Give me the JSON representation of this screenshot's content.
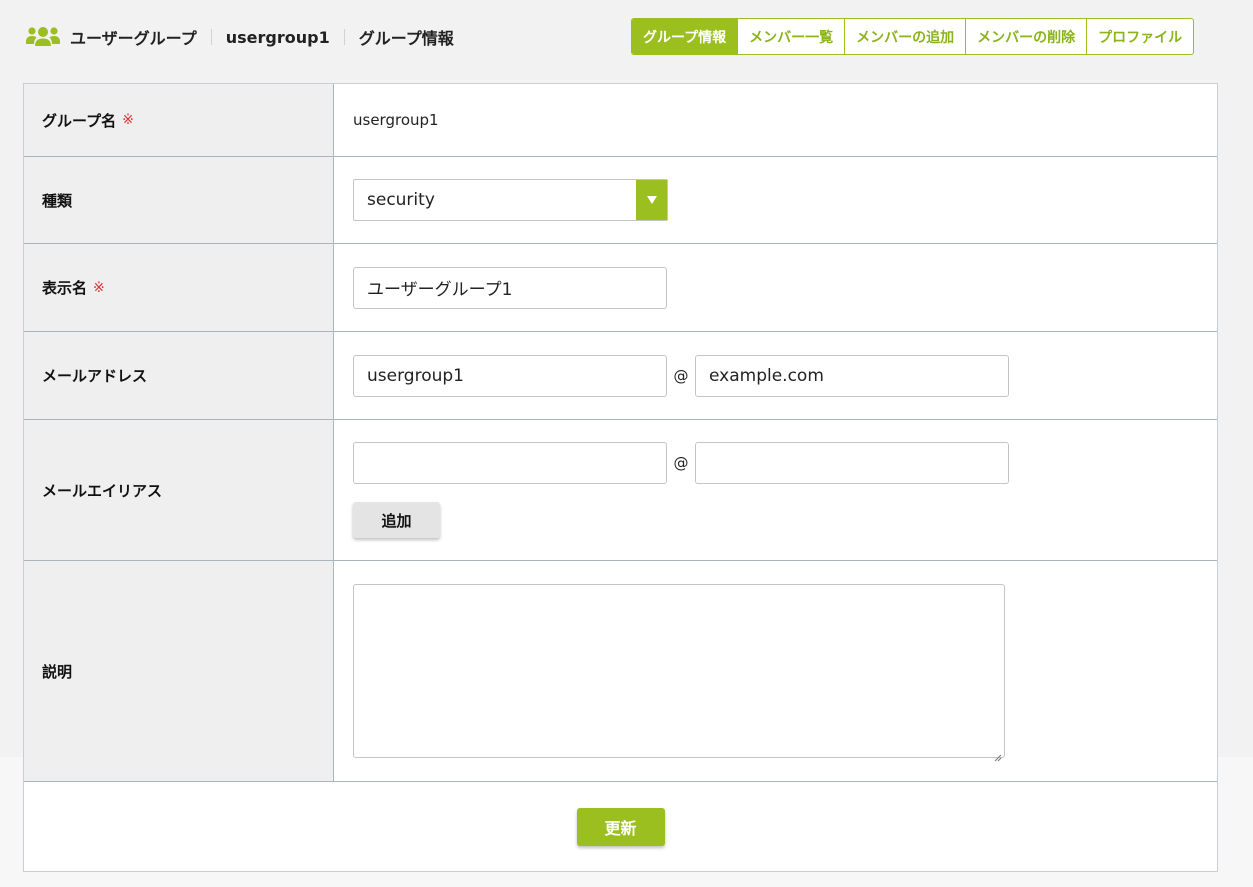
{
  "breadcrumb": {
    "icon": "users-icon",
    "items": [
      "ユーザーグループ",
      "usergroup1",
      "グループ情報"
    ]
  },
  "tabs": [
    {
      "label": "グループ情報",
      "active": true
    },
    {
      "label": "メンバー一覧",
      "active": false
    },
    {
      "label": "メンバーの追加",
      "active": false
    },
    {
      "label": "メンバーの削除",
      "active": false
    },
    {
      "label": "プロファイル",
      "active": false
    }
  ],
  "form": {
    "group_name": {
      "label": "グループ名",
      "required_mark": "※",
      "value": "usergroup1"
    },
    "type": {
      "label": "種類",
      "value": "security",
      "arrow_icon": "triangle-down-icon"
    },
    "display_name": {
      "label": "表示名",
      "required_mark": "※",
      "value": "ユーザーグループ1"
    },
    "email": {
      "label": "メールアドレス",
      "local": "usergroup1",
      "at": "@",
      "domain": "example.com"
    },
    "alias": {
      "label": "メールエイリアス",
      "local": "",
      "at": "@",
      "domain": "",
      "add_label": "追加"
    },
    "description": {
      "label": "説明",
      "value": ""
    },
    "submit_label": "更新"
  },
  "colors": {
    "accent": "#9abf1e",
    "label_bg": "#efefef",
    "required": "#d33333"
  }
}
